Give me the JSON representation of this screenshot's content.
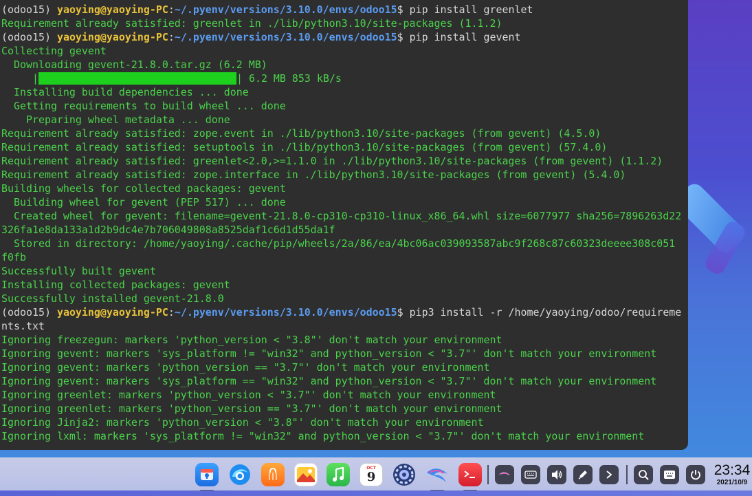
{
  "terminal": {
    "lines": [
      {
        "type": "prompt",
        "env": "(odoo15) ",
        "user": "yaoying@yaoying-PC",
        "colon": ":",
        "path": "~/.pyenv/versions/3.10.0/envs/odoo15",
        "cmd": "$ pip install greenlet"
      },
      {
        "type": "out",
        "text": "Requirement already satisfied: greenlet in ./lib/python3.10/site-packages (1.1.2)"
      },
      {
        "type": "prompt",
        "env": "(odoo15) ",
        "user": "yaoying@yaoying-PC",
        "colon": ":",
        "path": "~/.pyenv/versions/3.10.0/envs/odoo15",
        "cmd": "$ pip install gevent"
      },
      {
        "type": "out",
        "text": "Collecting gevent"
      },
      {
        "type": "out",
        "text": "  Downloading gevent-21.8.0.tar.gz (6.2 MB)"
      },
      {
        "type": "progress",
        "pre": "     |",
        "progress": 1.0,
        "post": "| 6.2 MB 853 kB/s"
      },
      {
        "type": "out",
        "text": "  Installing build dependencies ... done"
      },
      {
        "type": "out",
        "text": "  Getting requirements to build wheel ... done"
      },
      {
        "type": "out",
        "text": "    Preparing wheel metadata ... done"
      },
      {
        "type": "out",
        "text": "Requirement already satisfied: zope.event in ./lib/python3.10/site-packages (from gevent) (4.5.0)"
      },
      {
        "type": "out",
        "text": "Requirement already satisfied: setuptools in ./lib/python3.10/site-packages (from gevent) (57.4.0)"
      },
      {
        "type": "out",
        "text": "Requirement already satisfied: greenlet<2.0,>=1.1.0 in ./lib/python3.10/site-packages (from gevent) (1.1.2)"
      },
      {
        "type": "out",
        "text": "Requirement already satisfied: zope.interface in ./lib/python3.10/site-packages (from gevent) (5.4.0)"
      },
      {
        "type": "out",
        "text": "Building wheels for collected packages: gevent"
      },
      {
        "type": "out",
        "text": "  Building wheel for gevent (PEP 517) ... done"
      },
      {
        "type": "out",
        "text": "  Created wheel for gevent: filename=gevent-21.8.0-cp310-cp310-linux_x86_64.whl size=6077977 sha256=7896263d22"
      },
      {
        "type": "out",
        "text": "326fa1e8da133a1d2b9dc4e7b706049808a8525daf1c6d1d55da1f"
      },
      {
        "type": "out",
        "text": "  Stored in directory: /home/yaoying/.cache/pip/wheels/2a/86/ea/4bc06ac039093587abc9f268c87c60323deeee308c051"
      },
      {
        "type": "out",
        "text": "f0fb"
      },
      {
        "type": "out",
        "text": "Successfully built gevent"
      },
      {
        "type": "out",
        "text": "Installing collected packages: gevent"
      },
      {
        "type": "out",
        "text": "Successfully installed gevent-21.8.0"
      },
      {
        "type": "prompt",
        "env": "(odoo15) ",
        "user": "yaoying@yaoying-PC",
        "colon": ":",
        "path": "~/.pyenv/versions/3.10.0/envs/odoo15",
        "cmd": "$ pip3 install -r /home/yaoying/odoo/requireme"
      },
      {
        "type": "cmdcont",
        "text": "nts.txt"
      },
      {
        "type": "out",
        "text": "Ignoring freezegun: markers 'python_version < \"3.8\"' don't match your environment"
      },
      {
        "type": "out",
        "text": "Ignoring gevent: markers 'sys_platform != \"win32\" and python_version < \"3.7\"' don't match your environment"
      },
      {
        "type": "out",
        "text": "Ignoring gevent: markers 'python_version == \"3.7\"' don't match your environment"
      },
      {
        "type": "out",
        "text": "Ignoring gevent: markers 'sys_platform == \"win32\" and python_version < \"3.7\"' don't match your environment"
      },
      {
        "type": "out",
        "text": "Ignoring greenlet: markers 'python_version < \"3.7\"' don't match your environment"
      },
      {
        "type": "out",
        "text": "Ignoring greenlet: markers 'python_version == \"3.7\"' don't match your environment"
      },
      {
        "type": "out",
        "text": "Ignoring Jinja2: markers 'python_version < \"3.8\"' don't match your environment"
      },
      {
        "type": "out",
        "text": "Ignoring lxml: markers 'sys_platform != \"win32\" and python_version < \"3.7\"' don't match your environment"
      }
    ],
    "colors": {
      "output": "#4bd24b",
      "user": "#e8c23a",
      "path": "#5b9bf0",
      "background": "#2e2e2e"
    }
  },
  "taskbar": {
    "apps": [
      {
        "name": "app-store-icon",
        "running": true
      },
      {
        "name": "browser-icon",
        "running": false
      },
      {
        "name": "shopping-bag-icon",
        "running": false
      },
      {
        "name": "image-viewer-icon",
        "running": false
      },
      {
        "name": "music-icon",
        "running": false
      },
      {
        "name": "calendar-icon",
        "running": false,
        "month": "OCT",
        "day": "9"
      },
      {
        "name": "settings-icon",
        "running": false
      },
      {
        "name": "dragon-icon",
        "running": true
      },
      {
        "name": "terminal-icon",
        "running": true
      }
    ],
    "tray": [
      {
        "name": "dragon-tray-icon"
      },
      {
        "name": "keyboard-icon"
      },
      {
        "name": "volume-icon"
      },
      {
        "name": "pen-icon"
      },
      {
        "name": "chevron-right-icon"
      }
    ],
    "system": [
      {
        "name": "search-icon"
      },
      {
        "name": "onscreen-keyboard-icon"
      },
      {
        "name": "power-icon"
      }
    ],
    "clock": {
      "time": "23:34",
      "date": "2021/10/9"
    }
  }
}
